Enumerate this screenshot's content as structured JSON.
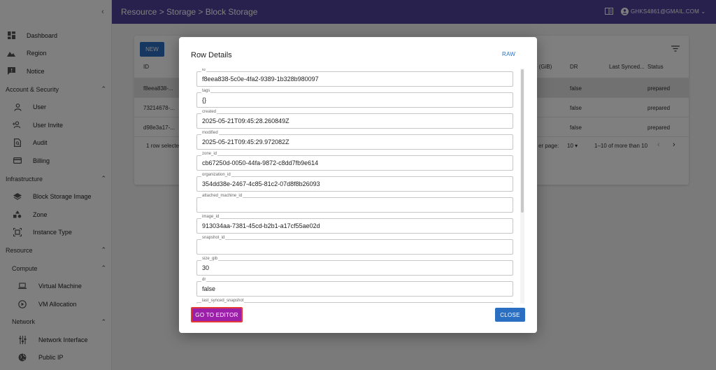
{
  "header": {
    "breadcrumb": "Resource > Storage > Block Storage",
    "email": "GHKS4861@GMAIL.COM",
    "email_caret": "⌄"
  },
  "sidebar": {
    "collapse_glyph": "‹",
    "dashboard": "Dashboard",
    "region": "Region",
    "notice": "Notice",
    "account_security": "Account & Security",
    "user": "User",
    "user_invite": "User Invite",
    "audit": "Audit",
    "billing": "Billing",
    "infrastructure": "Infrastructure",
    "block_storage_image": "Block Storage Image",
    "zone": "Zone",
    "instance_type": "Instance Type",
    "resource": "Resource",
    "compute": "Compute",
    "virtual_machine": "Virtual Machine",
    "vm_allocation": "VM Allocation",
    "network": "Network",
    "network_interface": "Network Interface",
    "public_ip": "Public IP",
    "chevron_up": "⌃"
  },
  "table": {
    "new_label": "NEW",
    "col_id": "ID",
    "col_size": "e (GiB)",
    "col_dr": "DR",
    "col_last_synced": "Last Synced...",
    "col_status": "Status",
    "rows": [
      {
        "id": "f8eea838-...",
        "dr": "false",
        "status": "prepared"
      },
      {
        "id": "73214678-...",
        "dr": "false",
        "status": "prepared"
      },
      {
        "id": "d98e3a17-...",
        "dr": "false",
        "status": "prepared"
      }
    ],
    "selected_text": "1 row selected",
    "rows_per_page": "er page:",
    "rows_per_page_value": "10",
    "rows_per_page_caret": "▾",
    "pagination": "1–10 of more than 10",
    "prev": "‹",
    "next": "›"
  },
  "dialog": {
    "title": "Row Details",
    "raw_label": "RAW",
    "fields": [
      {
        "label": "id",
        "value": "f8eea838-5c0e-4fa2-9389-1b328b980097"
      },
      {
        "label": "tags",
        "value": "{}"
      },
      {
        "label": "created",
        "value": "2025-05-21T09:45:28.260849Z"
      },
      {
        "label": "modified",
        "value": "2025-05-21T09:45:29.972082Z"
      },
      {
        "label": "zone_id",
        "value": "cb67250d-0050-44fa-9872-c8dd7fb9e614"
      },
      {
        "label": "organization_id",
        "value": "354dd38e-2467-4c85-81c2-07d8f8b26093"
      },
      {
        "label": "attached_machine_id",
        "value": ""
      },
      {
        "label": "image_id",
        "value": "913034aa-7381-45cd-b2b1-a17cf55ae02d"
      },
      {
        "label": "snapshot_id",
        "value": ""
      },
      {
        "label": "size_gib",
        "value": "30"
      },
      {
        "label": "dr",
        "value": "false"
      },
      {
        "label": "last_synced_snapshot",
        "value": ""
      }
    ],
    "go_to_editor": "GO TO EDITOR",
    "close": "CLOSE"
  },
  "colors": {
    "header": "#50439a",
    "primary": "#2a6fc1",
    "editor_button": "#9b1fa8",
    "editor_outline": "#e53935"
  }
}
